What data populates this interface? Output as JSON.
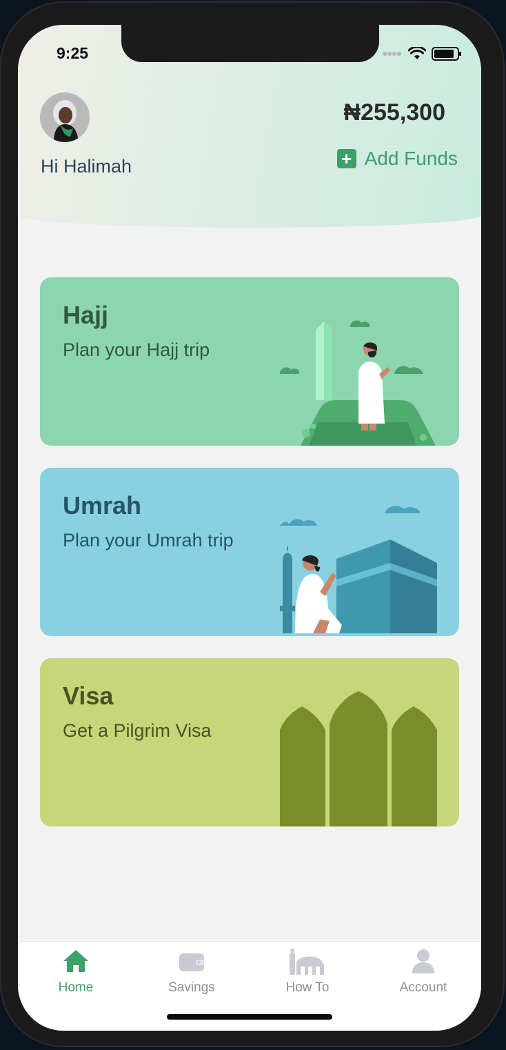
{
  "status_bar": {
    "time": "9:25"
  },
  "header": {
    "greeting": "Hi Halimah",
    "balance": "₦255,300",
    "add_funds_label": "Add Funds"
  },
  "cards": [
    {
      "title": "Hajj",
      "subtitle": "Plan your Hajj trip"
    },
    {
      "title": "Umrah",
      "subtitle": "Plan your Umrah trip"
    },
    {
      "title": "Visa",
      "subtitle": "Get a Pilgrim Visa"
    }
  ],
  "tabs": [
    {
      "label": "Home",
      "icon": "home-icon",
      "active": true
    },
    {
      "label": "Savings",
      "icon": "wallet-icon",
      "active": false
    },
    {
      "label": "How To",
      "icon": "mosque-icon",
      "active": false
    },
    {
      "label": "Account",
      "icon": "person-icon",
      "active": false
    }
  ],
  "colors": {
    "accent": "#3f9f68",
    "hajj_card": "#8dd5ae",
    "umrah_card": "#88d1e0",
    "visa_card": "#c8d67a",
    "inactive_tab": "#8e8e93"
  }
}
